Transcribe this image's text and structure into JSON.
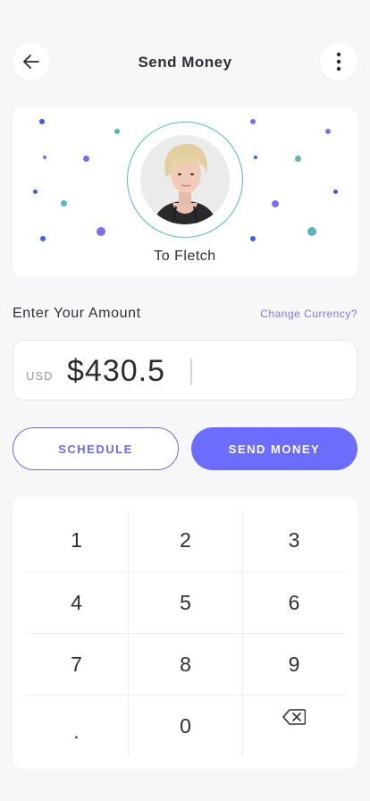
{
  "header": {
    "title": "Send Money",
    "back_icon": "arrow-left-icon",
    "more_icon": "more-vertical-icon"
  },
  "recipient": {
    "label": "To Fletch",
    "avatar": "avatar-photo"
  },
  "amount": {
    "label": "Enter Your Amount",
    "change_currency": "Change Currency?",
    "currency": "USD",
    "value": "$430.5"
  },
  "actions": {
    "schedule": "SCHEDULE",
    "send": "SEND MONEY"
  },
  "keypad": {
    "keys": [
      "1",
      "2",
      "3",
      "4",
      "5",
      "6",
      "7",
      "8",
      "9",
      ".",
      "0"
    ],
    "backspace_icon": "backspace-icon"
  },
  "colors": {
    "accent": "#6c6cff",
    "accent_text": "#6f6be0",
    "teal": "#5cb6b8",
    "background": "#f7f7f9"
  }
}
